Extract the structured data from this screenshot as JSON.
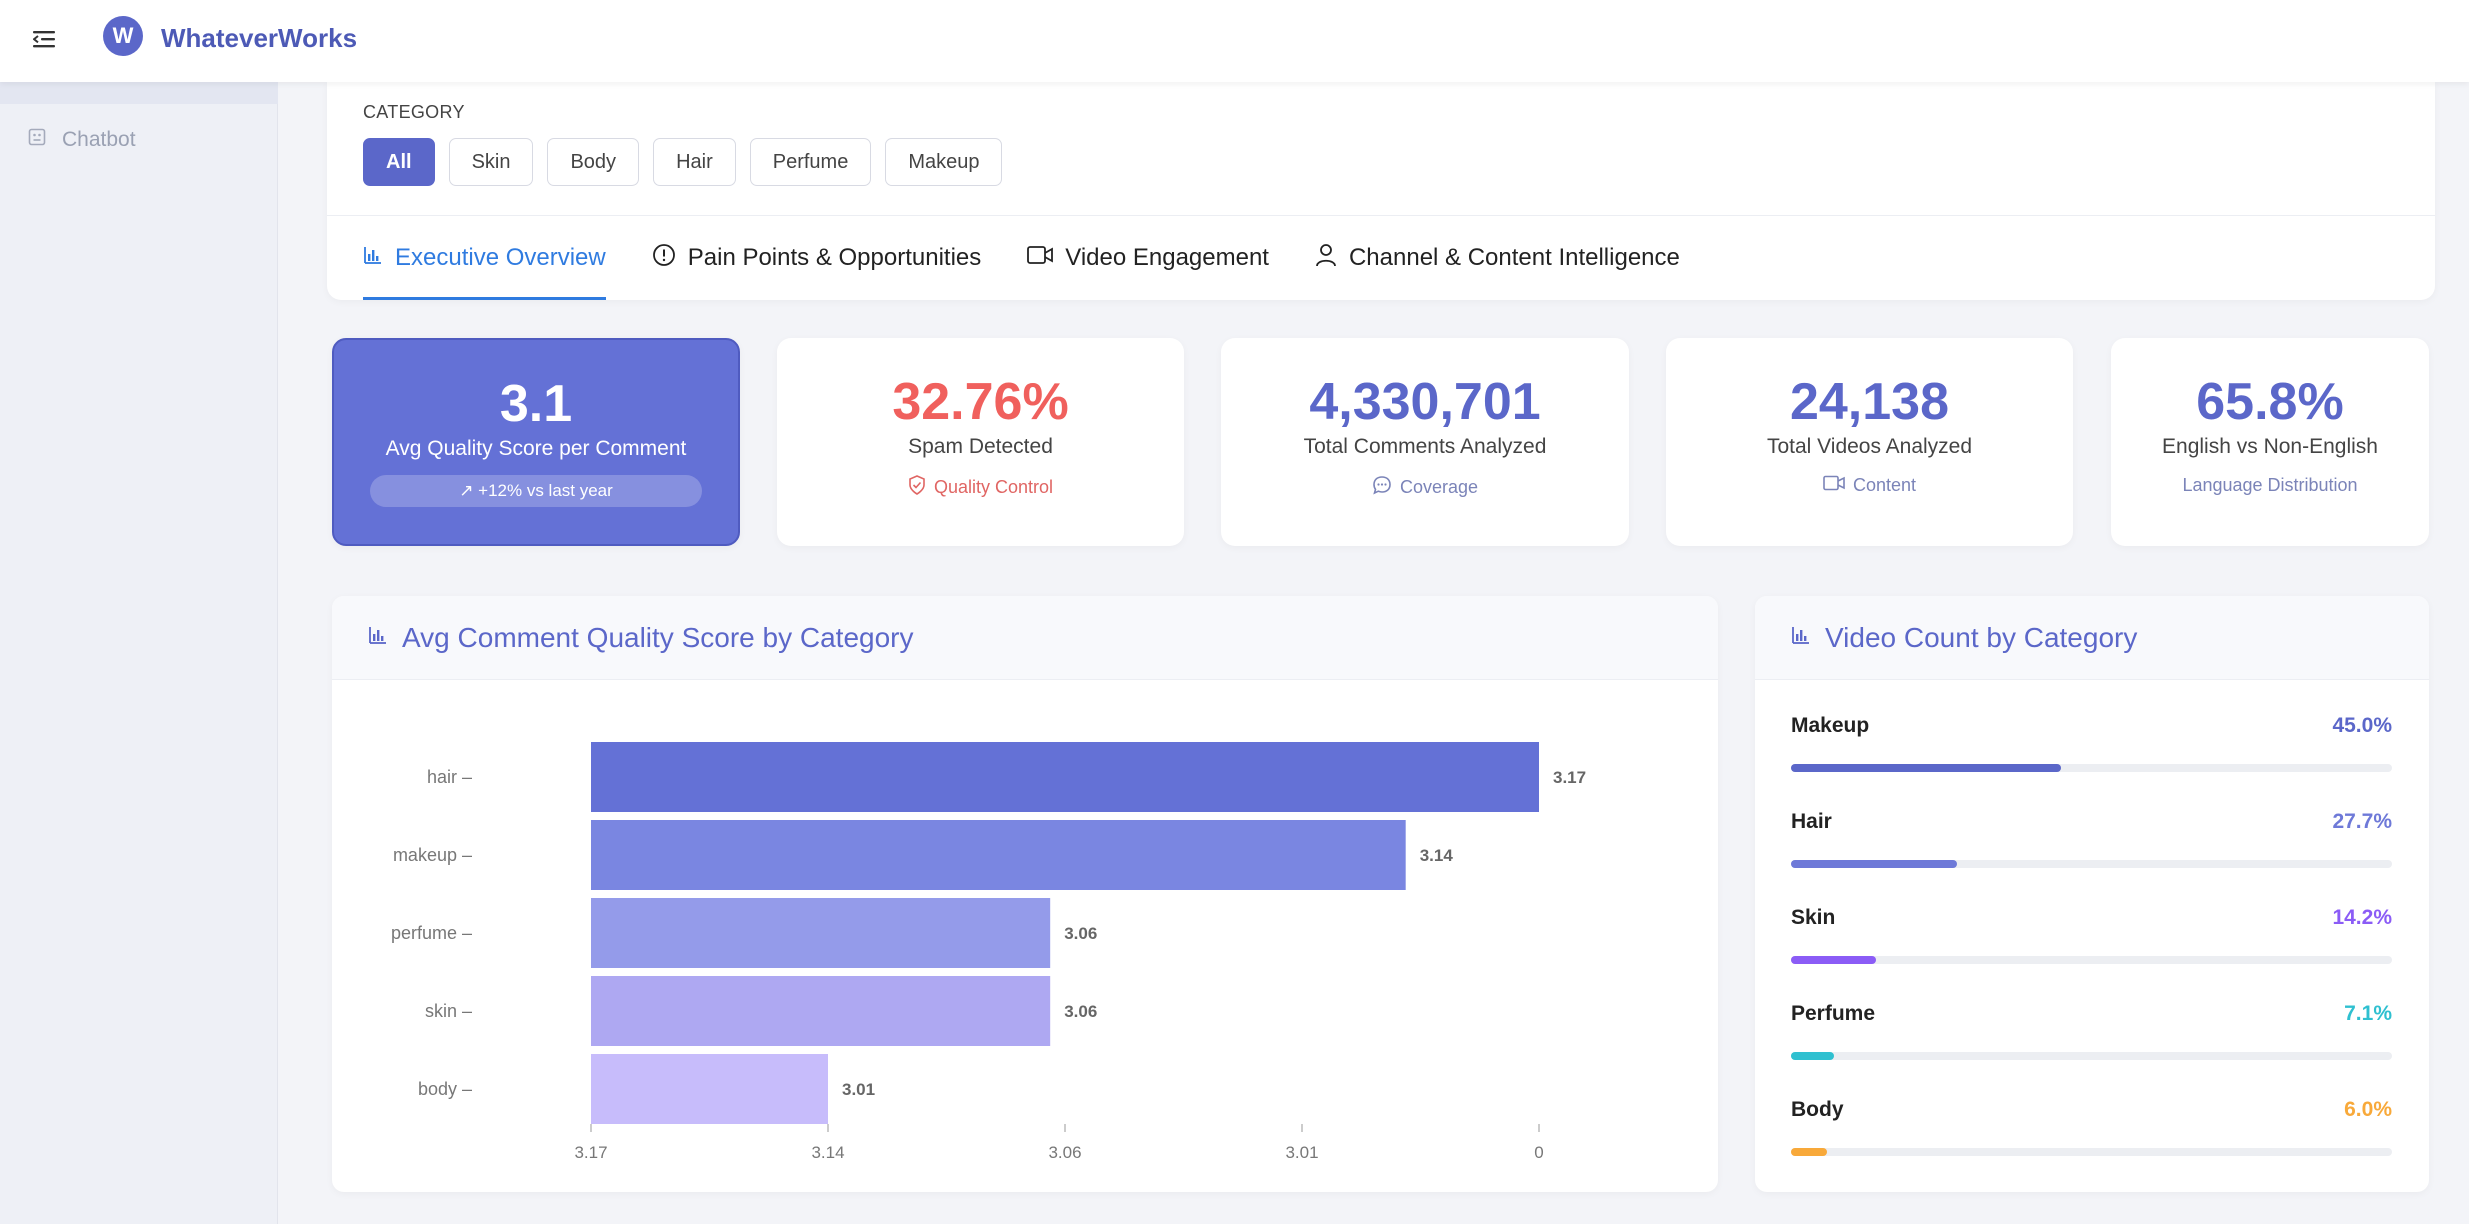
{
  "app": {
    "name": "WhateverWorks",
    "logo_letter": "W"
  },
  "sidebar": {
    "items": [
      {
        "label": "Chatbot",
        "icon": "bot-icon"
      }
    ]
  },
  "filters": {
    "label": "CATEGORY",
    "chips": [
      "All",
      "Skin",
      "Body",
      "Hair",
      "Perfume",
      "Makeup"
    ],
    "active": "All"
  },
  "tabs": [
    {
      "label": "Executive Overview",
      "icon": "bar-chart-icon",
      "active": true
    },
    {
      "label": "Pain Points & Opportunities",
      "icon": "alert-circle-icon",
      "active": false
    },
    {
      "label": "Video Engagement",
      "icon": "video-icon",
      "active": false
    },
    {
      "label": "Channel & Content Intelligence",
      "icon": "user-icon",
      "active": false
    }
  ],
  "kpis": [
    {
      "value": "3.1",
      "label": "Avg Quality Score per Comment",
      "badge": "↗ +12% vs last year"
    },
    {
      "value": "32.76%",
      "label": "Spam Detected",
      "sub": "Quality Control",
      "sub_icon": "shield-check-icon"
    },
    {
      "value": "4,330,701",
      "label": "Total Comments Analyzed",
      "sub": "Coverage",
      "sub_icon": "chat-bubble-icon"
    },
    {
      "value": "24,138",
      "label": "Total Videos Analyzed",
      "sub": "Content",
      "sub_icon": "video-icon"
    },
    {
      "value": "65.8%",
      "label": "English vs Non-English",
      "sub": "Language Distribution"
    }
  ],
  "colors": {
    "accent": "#5b67c9",
    "tab_active": "#2f7be0",
    "spam": "#f0605d",
    "bars": [
      "#6471d6",
      "#7a86e1",
      "#949bea",
      "#aea8f2",
      "#c7bcfb"
    ]
  },
  "quality_chart": {
    "title": "Avg Comment Quality Score by Category",
    "chart_data": {
      "type": "bar",
      "orientation": "horizontal",
      "categories": [
        "hair",
        "makeup",
        "perfume",
        "skin",
        "body"
      ],
      "values": [
        3.17,
        3.14,
        3.06,
        3.06,
        3.01
      ],
      "value_labels": [
        "3.17",
        "3.14",
        "3.06",
        "3.06",
        "3.01"
      ],
      "x_tick_labels": [
        "3.17",
        "3.14",
        "3.06",
        "3.01",
        "0"
      ],
      "xlabel": "",
      "ylabel": ""
    }
  },
  "video_chart": {
    "title": "Video Count by Category",
    "items": [
      {
        "name": "Makeup",
        "pct_label": "45.0%",
        "pct": 45.0,
        "color": "#5b67c9"
      },
      {
        "name": "Hair",
        "pct_label": "27.7%",
        "pct": 27.7,
        "color": "#6e79d8"
      },
      {
        "name": "Skin",
        "pct_label": "14.2%",
        "pct": 14.2,
        "color": "#8b5cf6"
      },
      {
        "name": "Perfume",
        "pct_label": "7.1%",
        "pct": 7.1,
        "color": "#2fc0d0"
      },
      {
        "name": "Body",
        "pct_label": "6.0%",
        "pct": 6.0,
        "color": "#f8a93a"
      }
    ]
  }
}
